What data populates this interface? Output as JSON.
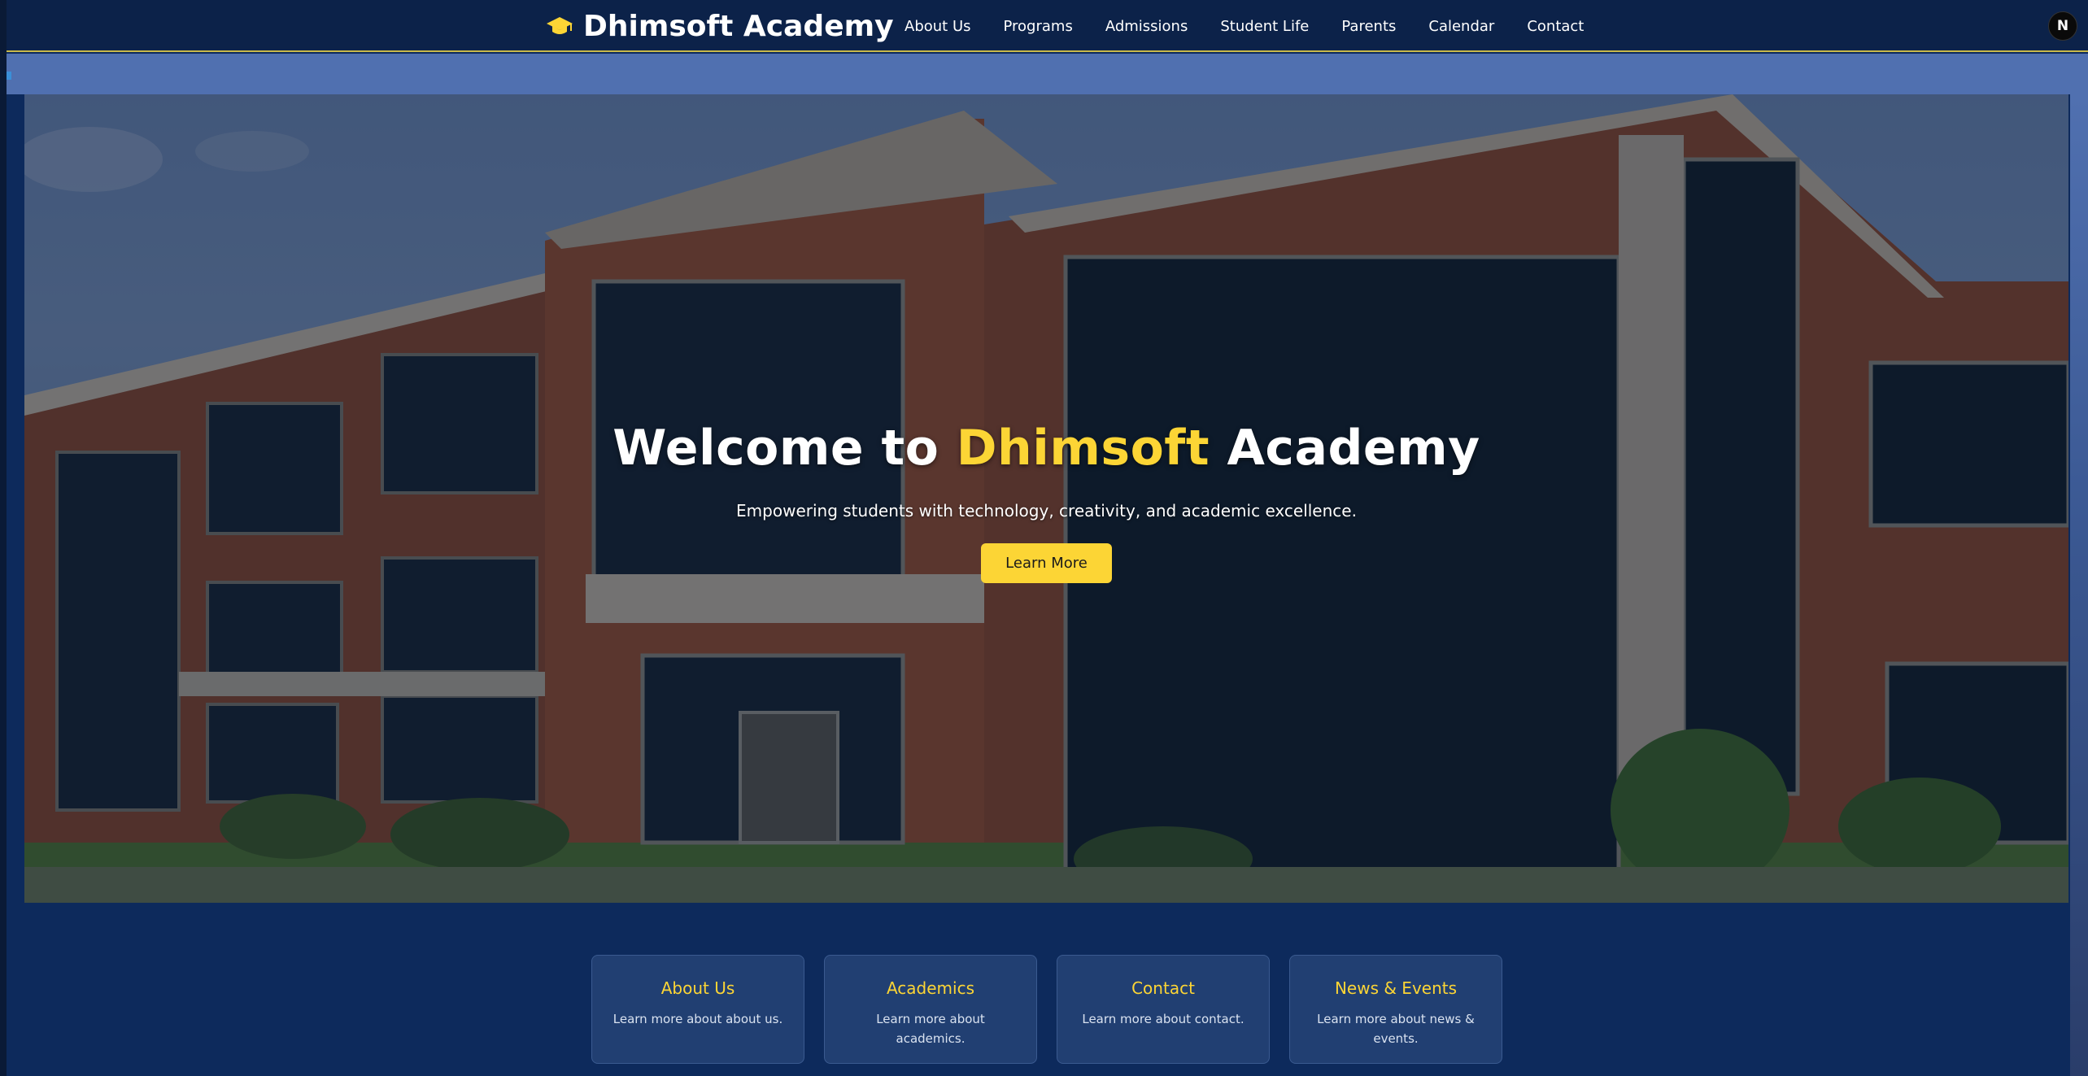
{
  "brand": {
    "name": "Dhimsoft Academy",
    "icon": "graduation-cap-icon"
  },
  "nav": {
    "links": [
      "About Us",
      "Programs",
      "Admissions",
      "Student Life",
      "Parents",
      "Calendar",
      "Contact"
    ],
    "badge": "N"
  },
  "hero": {
    "title_prefix": "Welcome to",
    "title_accent": "Dhimsoft",
    "title_suffix": "Academy",
    "subtitle": "Empowering students with technology, creativity, and academic excellence.",
    "button": "Learn More"
  },
  "cards": [
    {
      "title": "About Us",
      "text": "Learn more about about us."
    },
    {
      "title": "Academics",
      "text": "Learn more about academics."
    },
    {
      "title": "Contact",
      "text": "Learn more about contact."
    },
    {
      "title": "News & Events",
      "text": "Learn more about news & events."
    }
  ],
  "colors": {
    "accent": "#fcd535",
    "navbar": "#0c2249",
    "page_bg": "#0d2a5c",
    "card_bg": "#213f72"
  }
}
